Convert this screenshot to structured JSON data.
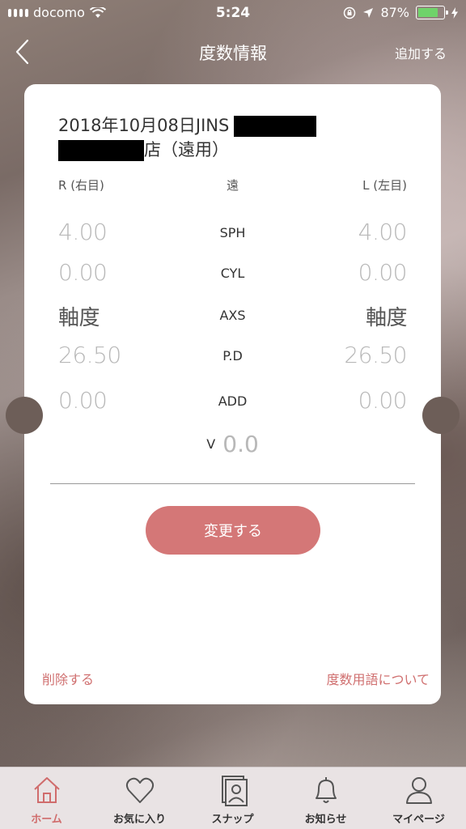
{
  "status_bar": {
    "carrier": "docomo",
    "time": "5:24",
    "battery": "87%",
    "battery_color": "#6fd36a"
  },
  "nav": {
    "title": "度数情報",
    "add_label": "追加する"
  },
  "record": {
    "title_prefix": "2018年10月08日JINS",
    "title_suffix": "店（遠用）"
  },
  "columns": {
    "right": "R (右目)",
    "middle": "遠",
    "left": "L (左目)"
  },
  "rows": [
    {
      "label": "SPH",
      "right": "4.00",
      "left": "4.00"
    },
    {
      "label": "CYL",
      "right": "0.00",
      "left": "0.00"
    },
    {
      "label": "AXS",
      "right": "軸度",
      "left": "軸度"
    },
    {
      "label": "P.D",
      "right": "26.50",
      "left": "26.50"
    },
    {
      "label": "ADD",
      "right": "0.00",
      "left": "0.00"
    }
  ],
  "vision": {
    "label": "V",
    "value": "0.0"
  },
  "actions": {
    "change_label": "変更する",
    "delete_label": "削除する",
    "terms_label": "度数用語について"
  },
  "tabs": [
    {
      "label": "ホーム",
      "icon": "home-icon",
      "active": true
    },
    {
      "label": "お気に入り",
      "icon": "heart-icon",
      "active": false
    },
    {
      "label": "スナップ",
      "icon": "snap-icon",
      "active": false
    },
    {
      "label": "お知らせ",
      "icon": "bell-icon",
      "active": false
    },
    {
      "label": "マイページ",
      "icon": "user-icon",
      "active": false
    }
  ],
  "colors": {
    "accent": "#d47777",
    "link": "#d07070",
    "active_tab": "#d06c6c"
  }
}
